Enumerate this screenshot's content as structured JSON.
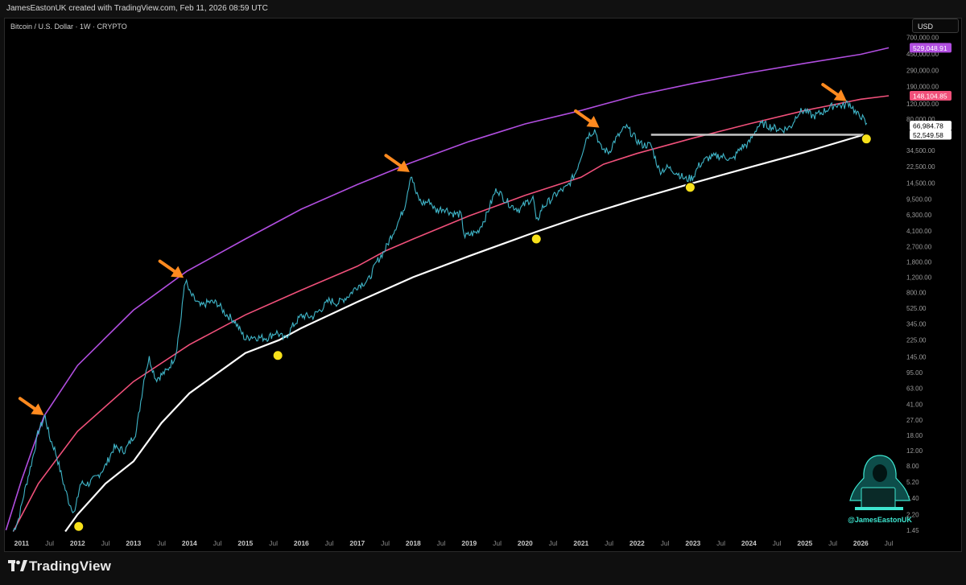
{
  "header": {
    "credit": "JamesEastonUK created with TradingView.com, Feb 11, 2026 08:59 UTC"
  },
  "chart_header": {
    "symbol": "Bitcoin / U.S. Dollar · 1W · CRYPTO",
    "currency_button": "USD"
  },
  "footer": {
    "brand": "TradingView"
  },
  "watermark": {
    "handle": "@JamesEastonUK"
  },
  "colors": {
    "background": "#000000",
    "price": "#3fb5c8",
    "upper_band": "#b14ee0",
    "mid_band": "#f0507a",
    "lower_band": "#ffffff",
    "support_line": "#bfbfbf",
    "arrow": "#ff8a1f",
    "marker": "#f7e11a"
  },
  "chart_data": {
    "type": "line",
    "y_scale": "log",
    "ylim": [
      1.3,
      800000
    ],
    "xlim": [
      2010.7,
      2026.7
    ],
    "x_ticks": [
      {
        "x": 2011.0,
        "label": "2011"
      },
      {
        "x": 2011.5,
        "label": "Jul"
      },
      {
        "x": 2012.0,
        "label": "2012"
      },
      {
        "x": 2012.5,
        "label": "Jul"
      },
      {
        "x": 2013.0,
        "label": "2013"
      },
      {
        "x": 2013.5,
        "label": "Jul"
      },
      {
        "x": 2014.0,
        "label": "2014"
      },
      {
        "x": 2014.5,
        "label": "Jul"
      },
      {
        "x": 2015.0,
        "label": "2015"
      },
      {
        "x": 2015.5,
        "label": "Jul"
      },
      {
        "x": 2016.0,
        "label": "2016"
      },
      {
        "x": 2016.5,
        "label": "Jul"
      },
      {
        "x": 2017.0,
        "label": "2017"
      },
      {
        "x": 2017.5,
        "label": "Jul"
      },
      {
        "x": 2018.0,
        "label": "2018"
      },
      {
        "x": 2018.5,
        "label": "Jul"
      },
      {
        "x": 2019.0,
        "label": "2019"
      },
      {
        "x": 2019.5,
        "label": "Jul"
      },
      {
        "x": 2020.0,
        "label": "2020"
      },
      {
        "x": 2020.5,
        "label": "Jul"
      },
      {
        "x": 2021.0,
        "label": "2021"
      },
      {
        "x": 2021.5,
        "label": "Jul"
      },
      {
        "x": 2022.0,
        "label": "2022"
      },
      {
        "x": 2022.5,
        "label": "Jul"
      },
      {
        "x": 2023.0,
        "label": "2023"
      },
      {
        "x": 2023.5,
        "label": "Jul"
      },
      {
        "x": 2024.0,
        "label": "2024"
      },
      {
        "x": 2024.5,
        "label": "Jul"
      },
      {
        "x": 2025.0,
        "label": "2025"
      },
      {
        "x": 2025.5,
        "label": "Jul"
      },
      {
        "x": 2026.0,
        "label": "2026"
      },
      {
        "x": 2026.5,
        "label": "Jul"
      }
    ],
    "y_ticks": [
      {
        "v": 700000,
        "label": "700,000.00"
      },
      {
        "v": 450000,
        "label": "450,000.00"
      },
      {
        "v": 290000,
        "label": "290,000.00"
      },
      {
        "v": 190000,
        "label": "190,000.00"
      },
      {
        "v": 120000,
        "label": "120,000.00"
      },
      {
        "v": 80000,
        "label": "80,000.00"
      },
      {
        "v": 34500,
        "label": "34,500.00"
      },
      {
        "v": 22500,
        "label": "22,500.00"
      },
      {
        "v": 14500,
        "label": "14,500.00"
      },
      {
        "v": 9500,
        "label": "9,500.00"
      },
      {
        "v": 6300,
        "label": "6,300.00"
      },
      {
        "v": 4100,
        "label": "4,100.00"
      },
      {
        "v": 2700,
        "label": "2,700.00"
      },
      {
        "v": 1800,
        "label": "1,800.00"
      },
      {
        "v": 1200,
        "label": "1,200.00"
      },
      {
        "v": 800,
        "label": "800.00"
      },
      {
        "v": 525,
        "label": "525.00"
      },
      {
        "v": 345,
        "label": "345.00"
      },
      {
        "v": 225,
        "label": "225.00"
      },
      {
        "v": 145,
        "label": "145.00"
      },
      {
        "v": 95,
        "label": "95.00"
      },
      {
        "v": 63,
        "label": "63.00"
      },
      {
        "v": 41,
        "label": "41.00"
      },
      {
        "v": 27,
        "label": "27.00"
      },
      {
        "v": 18,
        "label": "18.00"
      },
      {
        "v": 12,
        "label": "12.00"
      },
      {
        "v": 8,
        "label": "8.00"
      },
      {
        "v": 5.2,
        "label": "5.20"
      },
      {
        "v": 3.4,
        "label": "3.40"
      },
      {
        "v": 2.2,
        "label": "2.20"
      },
      {
        "v": 1.45,
        "label": "1.45"
      }
    ],
    "price_labels": [
      {
        "v": 529048.91,
        "label": "529,048.91",
        "bg": "#b14ee0",
        "fg": "#ffffff"
      },
      {
        "v": 148104.85,
        "label": "148,104.85",
        "bg": "#f0507a",
        "fg": "#ffffff"
      },
      {
        "v": 66984.78,
        "label": "66,984.78",
        "bg": "#ffffff",
        "fg": "#000000"
      },
      {
        "v": 52549.58,
        "label": "52,549.58",
        "bg": "#ffffff",
        "fg": "#000000"
      }
    ],
    "series": [
      {
        "role": "price",
        "color": "#3fb5c8",
        "points": [
          [
            2010.85,
            1.4
          ],
          [
            2010.95,
            2.0
          ],
          [
            2011.05,
            4
          ],
          [
            2011.2,
            10
          ],
          [
            2011.3,
            20
          ],
          [
            2011.42,
            30
          ],
          [
            2011.5,
            17
          ],
          [
            2011.6,
            12
          ],
          [
            2011.75,
            5
          ],
          [
            2011.85,
            3
          ],
          [
            2011.95,
            2.3
          ],
          [
            2012.05,
            5
          ],
          [
            2012.2,
            5
          ],
          [
            2012.35,
            6
          ],
          [
            2012.5,
            8
          ],
          [
            2012.65,
            13
          ],
          [
            2012.85,
            12
          ],
          [
            2013.05,
            20
          ],
          [
            2013.2,
            90
          ],
          [
            2013.28,
            140
          ],
          [
            2013.4,
            80
          ],
          [
            2013.6,
            100
          ],
          [
            2013.75,
            150
          ],
          [
            2013.85,
            400
          ],
          [
            2013.92,
            1150
          ],
          [
            2014.0,
            800
          ],
          [
            2014.1,
            650
          ],
          [
            2014.2,
            550
          ],
          [
            2014.35,
            620
          ],
          [
            2014.5,
            600
          ],
          [
            2014.65,
            450
          ],
          [
            2014.8,
            380
          ],
          [
            2015.0,
            230
          ],
          [
            2015.1,
            250
          ],
          [
            2015.25,
            240
          ],
          [
            2015.4,
            240
          ],
          [
            2015.55,
            280
          ],
          [
            2015.7,
            230
          ],
          [
            2015.85,
            330
          ],
          [
            2016.0,
            430
          ],
          [
            2016.2,
            420
          ],
          [
            2016.4,
            550
          ],
          [
            2016.5,
            650
          ],
          [
            2016.65,
            600
          ],
          [
            2016.85,
            740
          ],
          [
            2017.0,
            950
          ],
          [
            2017.2,
            1100
          ],
          [
            2017.35,
            1800
          ],
          [
            2017.5,
            2500
          ],
          [
            2017.6,
            3500
          ],
          [
            2017.75,
            5500
          ],
          [
            2017.85,
            8000
          ],
          [
            2017.96,
            19000
          ],
          [
            2018.05,
            11000
          ],
          [
            2018.15,
            8500
          ],
          [
            2018.3,
            9000
          ],
          [
            2018.4,
            7000
          ],
          [
            2018.55,
            7500
          ],
          [
            2018.7,
            6500
          ],
          [
            2018.85,
            6300
          ],
          [
            2018.92,
            3500
          ],
          [
            2019.0,
            3700
          ],
          [
            2019.15,
            4000
          ],
          [
            2019.3,
            6000
          ],
          [
            2019.45,
            11000
          ],
          [
            2019.5,
            12500
          ],
          [
            2019.6,
            10000
          ],
          [
            2019.75,
            8000
          ],
          [
            2019.9,
            7200
          ],
          [
            2020.05,
            9000
          ],
          [
            2020.15,
            9800
          ],
          [
            2020.2,
            5000
          ],
          [
            2020.3,
            7500
          ],
          [
            2020.45,
            9300
          ],
          [
            2020.6,
            11500
          ],
          [
            2020.75,
            13000
          ],
          [
            2020.9,
            19000
          ],
          [
            2021.0,
            30000
          ],
          [
            2021.1,
            50000
          ],
          [
            2021.25,
            60000
          ],
          [
            2021.35,
            37000
          ],
          [
            2021.5,
            33000
          ],
          [
            2021.6,
            45000
          ],
          [
            2021.8,
            65000
          ],
          [
            2021.9,
            55000
          ],
          [
            2022.0,
            45000
          ],
          [
            2022.1,
            40000
          ],
          [
            2022.25,
            40000
          ],
          [
            2022.4,
            20000
          ],
          [
            2022.55,
            22000
          ],
          [
            2022.7,
            19500
          ],
          [
            2022.87,
            16000
          ],
          [
            2023.0,
            17000
          ],
          [
            2023.1,
            23000
          ],
          [
            2023.25,
            28000
          ],
          [
            2023.45,
            30000
          ],
          [
            2023.6,
            29000
          ],
          [
            2023.7,
            26500
          ],
          [
            2023.85,
            37000
          ],
          [
            2024.0,
            42000
          ],
          [
            2024.15,
            65000
          ],
          [
            2024.25,
            70000
          ],
          [
            2024.45,
            63000
          ],
          [
            2024.6,
            60000
          ],
          [
            2024.75,
            65000
          ],
          [
            2024.88,
            95000
          ],
          [
            2025.0,
            100000
          ],
          [
            2025.15,
            85000
          ],
          [
            2025.3,
            95000
          ],
          [
            2025.45,
            108000
          ],
          [
            2025.55,
            118000
          ],
          [
            2025.7,
            112000
          ],
          [
            2025.77,
            125000
          ],
          [
            2025.85,
            110000
          ],
          [
            2025.92,
            90000
          ],
          [
            2026.0,
            88000
          ],
          [
            2026.06,
            76000
          ],
          [
            2026.11,
            66984.78
          ]
        ]
      },
      {
        "role": "upper_band",
        "color": "#b14ee0",
        "points": [
          [
            2010.72,
            1.45
          ],
          [
            2011.0,
            5.5
          ],
          [
            2011.4,
            30
          ],
          [
            2012.0,
            115
          ],
          [
            2013.0,
            500
          ],
          [
            2013.95,
            1400
          ],
          [
            2015.0,
            3300
          ],
          [
            2016.0,
            7300
          ],
          [
            2017.0,
            14000
          ],
          [
            2017.96,
            25000
          ],
          [
            2019.0,
            44000
          ],
          [
            2020.0,
            70000
          ],
          [
            2021.0,
            100000
          ],
          [
            2021.4,
            118000
          ],
          [
            2022.0,
            150000
          ],
          [
            2023.0,
            205000
          ],
          [
            2024.0,
            272000
          ],
          [
            2025.0,
            350000
          ],
          [
            2026.0,
            445000
          ],
          [
            2026.5,
            529048.91
          ]
        ]
      },
      {
        "role": "mid_band",
        "color": "#f0507a",
        "points": [
          [
            2010.85,
            1.4
          ],
          [
            2011.3,
            5
          ],
          [
            2012.0,
            20
          ],
          [
            2013.0,
            75
          ],
          [
            2014.0,
            200
          ],
          [
            2015.0,
            440
          ],
          [
            2016.0,
            850
          ],
          [
            2017.0,
            1600
          ],
          [
            2017.5,
            2400
          ],
          [
            2018.0,
            3300
          ],
          [
            2019.0,
            6100
          ],
          [
            2020.0,
            10500
          ],
          [
            2021.0,
            17000
          ],
          [
            2021.4,
            24000
          ],
          [
            2022.0,
            32000
          ],
          [
            2023.0,
            48000
          ],
          [
            2024.0,
            70000
          ],
          [
            2025.0,
            100000
          ],
          [
            2026.0,
            135000
          ],
          [
            2026.5,
            148104.85
          ]
        ]
      },
      {
        "role": "lower_band",
        "color": "#ffffff",
        "points": [
          [
            2011.78,
            1.4
          ],
          [
            2012.0,
            2.2
          ],
          [
            2012.5,
            5
          ],
          [
            2013.0,
            9
          ],
          [
            2013.5,
            25
          ],
          [
            2014.0,
            55
          ],
          [
            2015.0,
            160
          ],
          [
            2015.6,
            225
          ],
          [
            2016.0,
            310
          ],
          [
            2017.0,
            620
          ],
          [
            2018.0,
            1200
          ],
          [
            2019.0,
            2100
          ],
          [
            2020.0,
            3600
          ],
          [
            2020.2,
            4000
          ],
          [
            2021.0,
            6000
          ],
          [
            2022.0,
            9500
          ],
          [
            2022.9,
            14000
          ],
          [
            2024.0,
            22000
          ],
          [
            2025.0,
            33000
          ],
          [
            2026.05,
            52549.58
          ]
        ]
      }
    ],
    "support_line": {
      "x": [
        2022.25,
        2026.05
      ],
      "y": 52549.58
    },
    "arrows": [
      {
        "x": 2011.42,
        "y": 30
      },
      {
        "x": 2013.92,
        "y": 1150
      },
      {
        "x": 2017.96,
        "y": 19000
      },
      {
        "x": 2021.35,
        "y": 62000
      },
      {
        "x": 2025.77,
        "y": 125000
      }
    ],
    "markers": [
      {
        "x": 2012.02,
        "y": 1.6
      },
      {
        "x": 2015.58,
        "y": 150
      },
      {
        "x": 2020.2,
        "y": 3300
      },
      {
        "x": 2022.95,
        "y": 13000
      },
      {
        "x": 2026.1,
        "y": 47000
      }
    ]
  }
}
